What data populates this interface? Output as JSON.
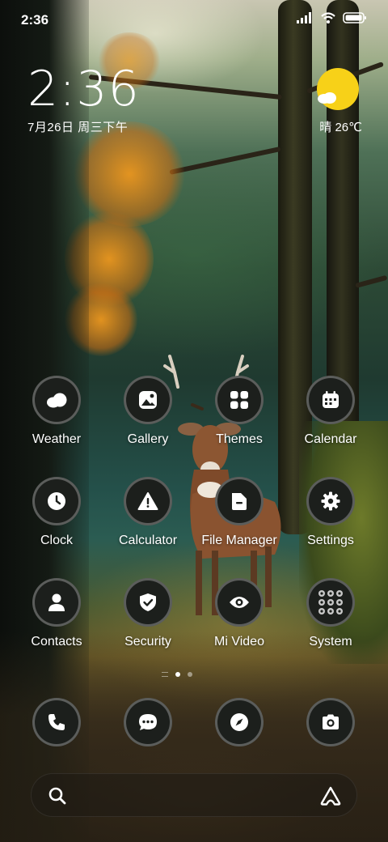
{
  "status_bar": {
    "time": "2:36",
    "icons": [
      "signal-icon",
      "wifi-icon",
      "battery-icon"
    ]
  },
  "clock_widget": {
    "time": "2:36",
    "date": "7月26日 周三下午"
  },
  "weather_widget": {
    "icon": "sunny-cloud-icon",
    "text": "晴 26℃",
    "sun_color": "#f7d118"
  },
  "apps": [
    {
      "label": "Weather",
      "icon": "weather-cloud-icon"
    },
    {
      "label": "Gallery",
      "icon": "gallery-icon"
    },
    {
      "label": "Themes",
      "icon": "themes-grid-icon"
    },
    {
      "label": "Calendar",
      "icon": "calendar-icon"
    },
    {
      "label": "Clock",
      "icon": "clock-icon"
    },
    {
      "label": "Calculator",
      "icon": "warning-triangle-icon"
    },
    {
      "label": "File Manager",
      "icon": "folder-icon"
    },
    {
      "label": "Settings",
      "icon": "gear-icon"
    },
    {
      "label": "Contacts",
      "icon": "person-icon"
    },
    {
      "label": "Security",
      "icon": "shield-check-icon"
    },
    {
      "label": "Mi Video",
      "icon": "eye-icon"
    },
    {
      "label": "System",
      "icon": "app-folder-icon"
    }
  ],
  "page_indicator": {
    "pages": 2,
    "active": 1
  },
  "dock": [
    {
      "icon": "phone-icon"
    },
    {
      "icon": "message-icon"
    },
    {
      "icon": "compass-icon"
    },
    {
      "icon": "camera-icon"
    }
  ],
  "search_bar": {
    "icon": "search-icon",
    "assistant_icon": "assistant-icon"
  },
  "colors": {
    "icon_bg": "#1c1f1c",
    "sun": "#f7d118"
  }
}
